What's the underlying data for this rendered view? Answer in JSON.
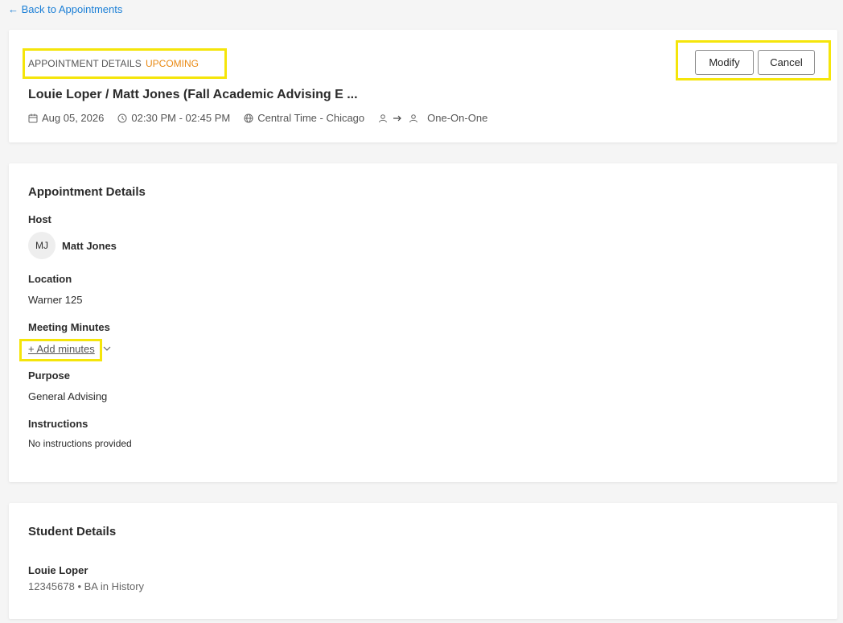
{
  "nav": {
    "back_label": "← Back to Appointments"
  },
  "header": {
    "label": "APPOINTMENT DETAILS",
    "status": "UPCOMING",
    "title": "Louie Loper / Matt Jones (Fall Academic Advising E ...",
    "date": "Aug 05, 2026",
    "time": "02:30 PM - 02:45 PM",
    "timezone": "Central Time - Chicago",
    "meeting_type": "One-On-One",
    "modify_label": "Modify",
    "cancel_label": "Cancel"
  },
  "details": {
    "section_title": "Appointment Details",
    "host_label": "Host",
    "host_initials": "MJ",
    "host_name": "Matt Jones",
    "location_label": "Location",
    "location_value": "Warner 125",
    "minutes_label": "Meeting Minutes",
    "add_minutes_label": "+ Add minutes",
    "purpose_label": "Purpose",
    "purpose_value": "General Advising",
    "instructions_label": "Instructions",
    "instructions_value": "No instructions provided"
  },
  "student": {
    "section_title": "Student Details",
    "name": "Louie Loper",
    "meta": "12345678 • BA in History"
  },
  "colors": {
    "link": "#1b7fd6",
    "status": "#e98a14",
    "highlight": "#f5e50a"
  }
}
